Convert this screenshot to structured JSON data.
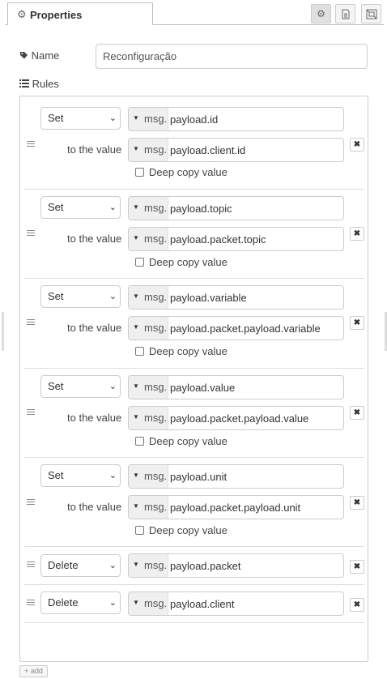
{
  "tabs": {
    "properties_label": "Properties"
  },
  "icons": {
    "settings": "gear-icon",
    "description": "document-icon",
    "appearance": "layout-frame-icon",
    "name": "tag-icon",
    "rules": "list-icon",
    "drag": "drag-handle-icon",
    "remove": "close-icon"
  },
  "form": {
    "name_label": "Name",
    "name_value": "Reconfiguração",
    "rules_label": "Rules"
  },
  "rules": [
    {
      "action": "Set",
      "prefix": "msg.",
      "target": "payload.id",
      "to_label": "to the value",
      "value_prefix": "msg.",
      "value": "payload.client.id",
      "deep_copy_label": "Deep copy value",
      "deep_copy_checked": false
    },
    {
      "action": "Set",
      "prefix": "msg.",
      "target": "payload.topic",
      "to_label": "to the value",
      "value_prefix": "msg.",
      "value": "payload.packet.topic",
      "deep_copy_label": "Deep copy value",
      "deep_copy_checked": false
    },
    {
      "action": "Set",
      "prefix": "msg.",
      "target": "payload.variable",
      "to_label": "to the value",
      "value_prefix": "msg.",
      "value": "payload.packet.payload.variable",
      "deep_copy_label": "Deep copy value",
      "deep_copy_checked": false
    },
    {
      "action": "Set",
      "prefix": "msg.",
      "target": "payload.value",
      "to_label": "to the value",
      "value_prefix": "msg.",
      "value": "payload.packet.payload.value",
      "deep_copy_label": "Deep copy value",
      "deep_copy_checked": false
    },
    {
      "action": "Set",
      "prefix": "msg.",
      "target": "payload.unit",
      "to_label": "to the value",
      "value_prefix": "msg.",
      "value": "payload.packet.payload.unit",
      "deep_copy_label": "Deep copy value",
      "deep_copy_checked": false
    },
    {
      "action": "Delete",
      "prefix": "msg.",
      "target": "payload.packet"
    },
    {
      "action": "Delete",
      "prefix": "msg.",
      "target": "payload.client"
    }
  ],
  "add_button_label": "add"
}
